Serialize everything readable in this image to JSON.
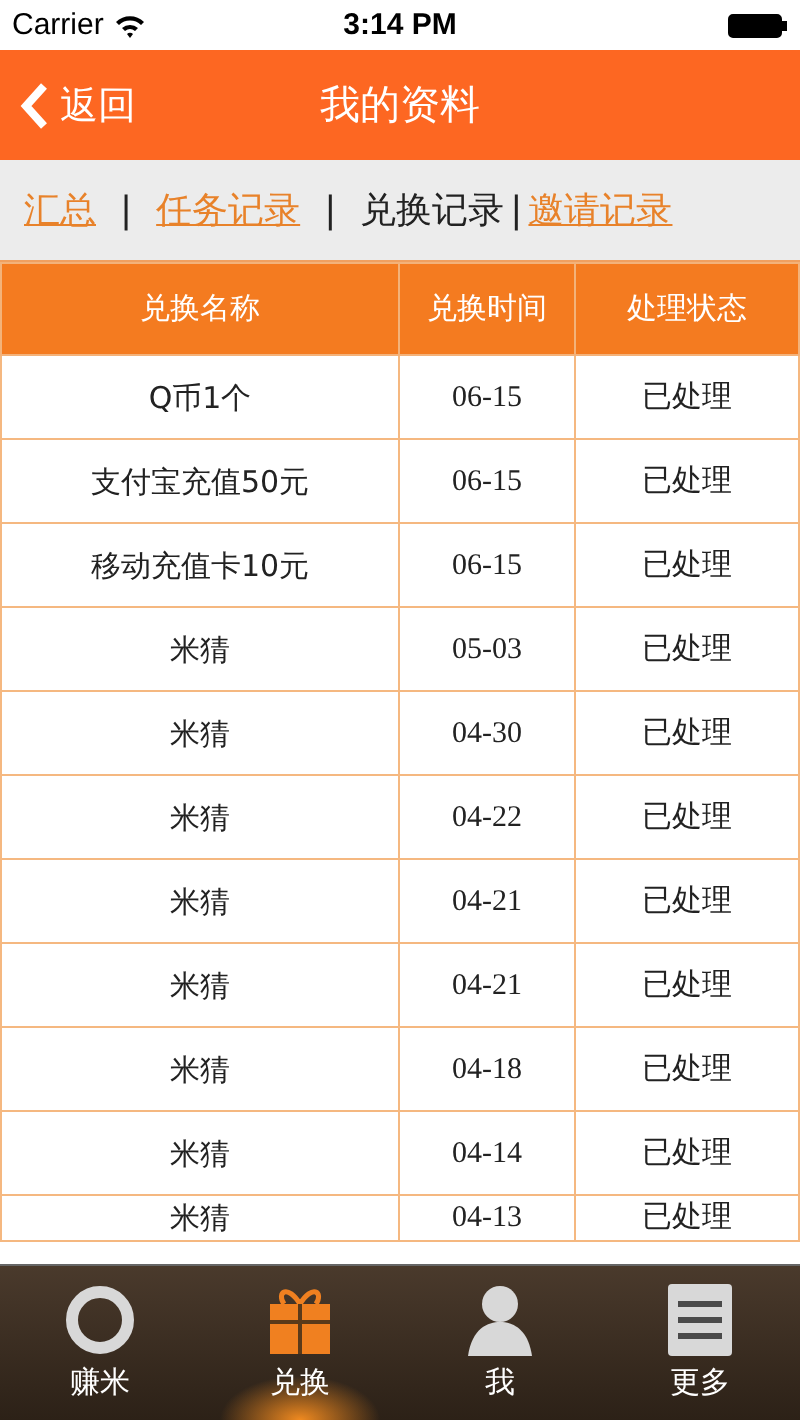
{
  "status_bar": {
    "carrier": "Carrier",
    "time": "3:14 PM"
  },
  "nav_bar": {
    "back": "返回",
    "title": "我的资料"
  },
  "tabs": [
    {
      "label": "汇总",
      "selected": false
    },
    {
      "label": "任务记录",
      "selected": false
    },
    {
      "label": "兑换记录",
      "selected": true
    },
    {
      "label": "邀请记录",
      "selected": false
    }
  ],
  "tab_separators": [
    "|",
    "|",
    "|"
  ],
  "table": {
    "columns": [
      "兑换名称",
      "兑换时间",
      "处理状态"
    ],
    "rows": [
      [
        "Q币1个",
        "06-15",
        "已处理"
      ],
      [
        "支付宝充值50元",
        "06-15",
        "已处理"
      ],
      [
        "移动充值卡10元",
        "06-15",
        "已处理"
      ],
      [
        "米猜",
        "05-03",
        "已处理"
      ],
      [
        "米猜",
        "04-30",
        "已处理"
      ],
      [
        "米猜",
        "04-22",
        "已处理"
      ],
      [
        "米猜",
        "04-21",
        "已处理"
      ],
      [
        "米猜",
        "04-21",
        "已处理"
      ],
      [
        "米猜",
        "04-18",
        "已处理"
      ],
      [
        "米猜",
        "04-14",
        "已处理"
      ],
      [
        "米猜",
        "04-13",
        "已处理"
      ]
    ]
  },
  "tab_bar": [
    {
      "label": "赚米",
      "kind": "ring",
      "selected": false
    },
    {
      "label": "兑换",
      "kind": "gift",
      "selected": true
    },
    {
      "label": "我",
      "kind": "person",
      "selected": false
    },
    {
      "label": "更多",
      "kind": "list",
      "selected": false
    }
  ]
}
